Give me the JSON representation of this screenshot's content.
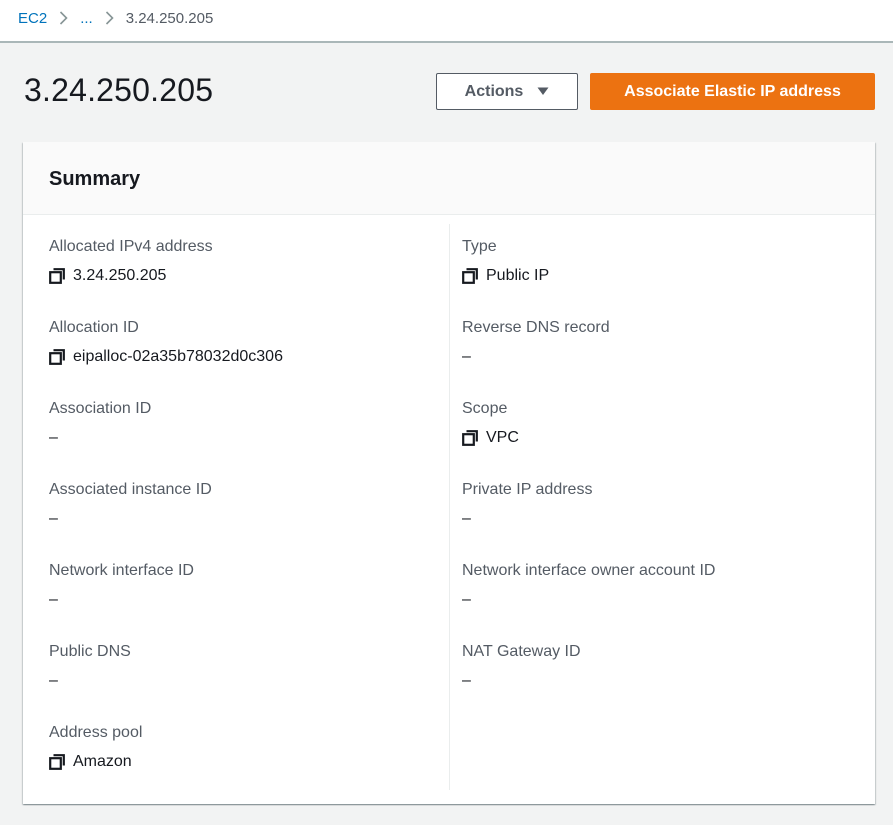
{
  "breadcrumb": {
    "root": "EC2",
    "ellipsis": "...",
    "current": "3.24.250.205"
  },
  "page": {
    "title": "3.24.250.205"
  },
  "buttons": {
    "actions": "Actions",
    "associate": "Associate Elastic IP address"
  },
  "summary": {
    "title": "Summary",
    "left": [
      {
        "label": "Allocated IPv4 address",
        "value": "3.24.250.205",
        "copy": true
      },
      {
        "label": "Allocation ID",
        "value": "eipalloc-02a35b78032d0c306",
        "copy": true
      },
      {
        "label": "Association ID",
        "value": "–",
        "copy": false
      },
      {
        "label": "Associated instance ID",
        "value": "–",
        "copy": false
      },
      {
        "label": "Network interface ID",
        "value": "–",
        "copy": false
      },
      {
        "label": "Public DNS",
        "value": "–",
        "copy": false
      },
      {
        "label": "Address pool",
        "value": "Amazon",
        "copy": true
      }
    ],
    "right": [
      {
        "label": "Type",
        "value": "Public IP",
        "copy": true
      },
      {
        "label": "Reverse DNS record",
        "value": "–",
        "copy": false
      },
      {
        "label": "Scope",
        "value": "VPC",
        "copy": true
      },
      {
        "label": "Private IP address",
        "value": "–",
        "copy": false
      },
      {
        "label": "Network interface owner account ID",
        "value": "–",
        "copy": false
      },
      {
        "label": "NAT Gateway ID",
        "value": "–",
        "copy": false
      }
    ]
  },
  "colors": {
    "primary": "#ec7211",
    "link": "#0073bb",
    "label": "#545b64"
  }
}
